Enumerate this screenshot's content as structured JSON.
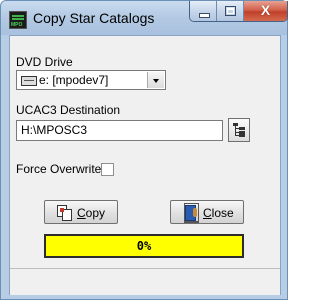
{
  "window": {
    "title": "Copy Star Catalogs",
    "app_icon": "mpo-app-icon",
    "app_icon_text": "MPO",
    "caption_buttons": {
      "minimize_icon": "minimize-icon",
      "maximize_icon": "maximize-icon",
      "close_glyph": "X"
    }
  },
  "form": {
    "dvd_drive": {
      "label": "DVD Drive",
      "selected": "e: [mpodev7]",
      "icon": "drive-icon"
    },
    "destination": {
      "label": "UCAC3 Destination",
      "value": "H:\\MPOSC3",
      "browse_icon": "folder-tree-icon"
    },
    "force_overwrite": {
      "label": "Force Overwrite",
      "checked": false
    }
  },
  "buttons": {
    "copy_label": "Copy",
    "close_label": "Close"
  },
  "progress": {
    "text": "0%",
    "value_percent": 0,
    "color": "#ffff00"
  },
  "status_bar": {
    "text": ""
  }
}
